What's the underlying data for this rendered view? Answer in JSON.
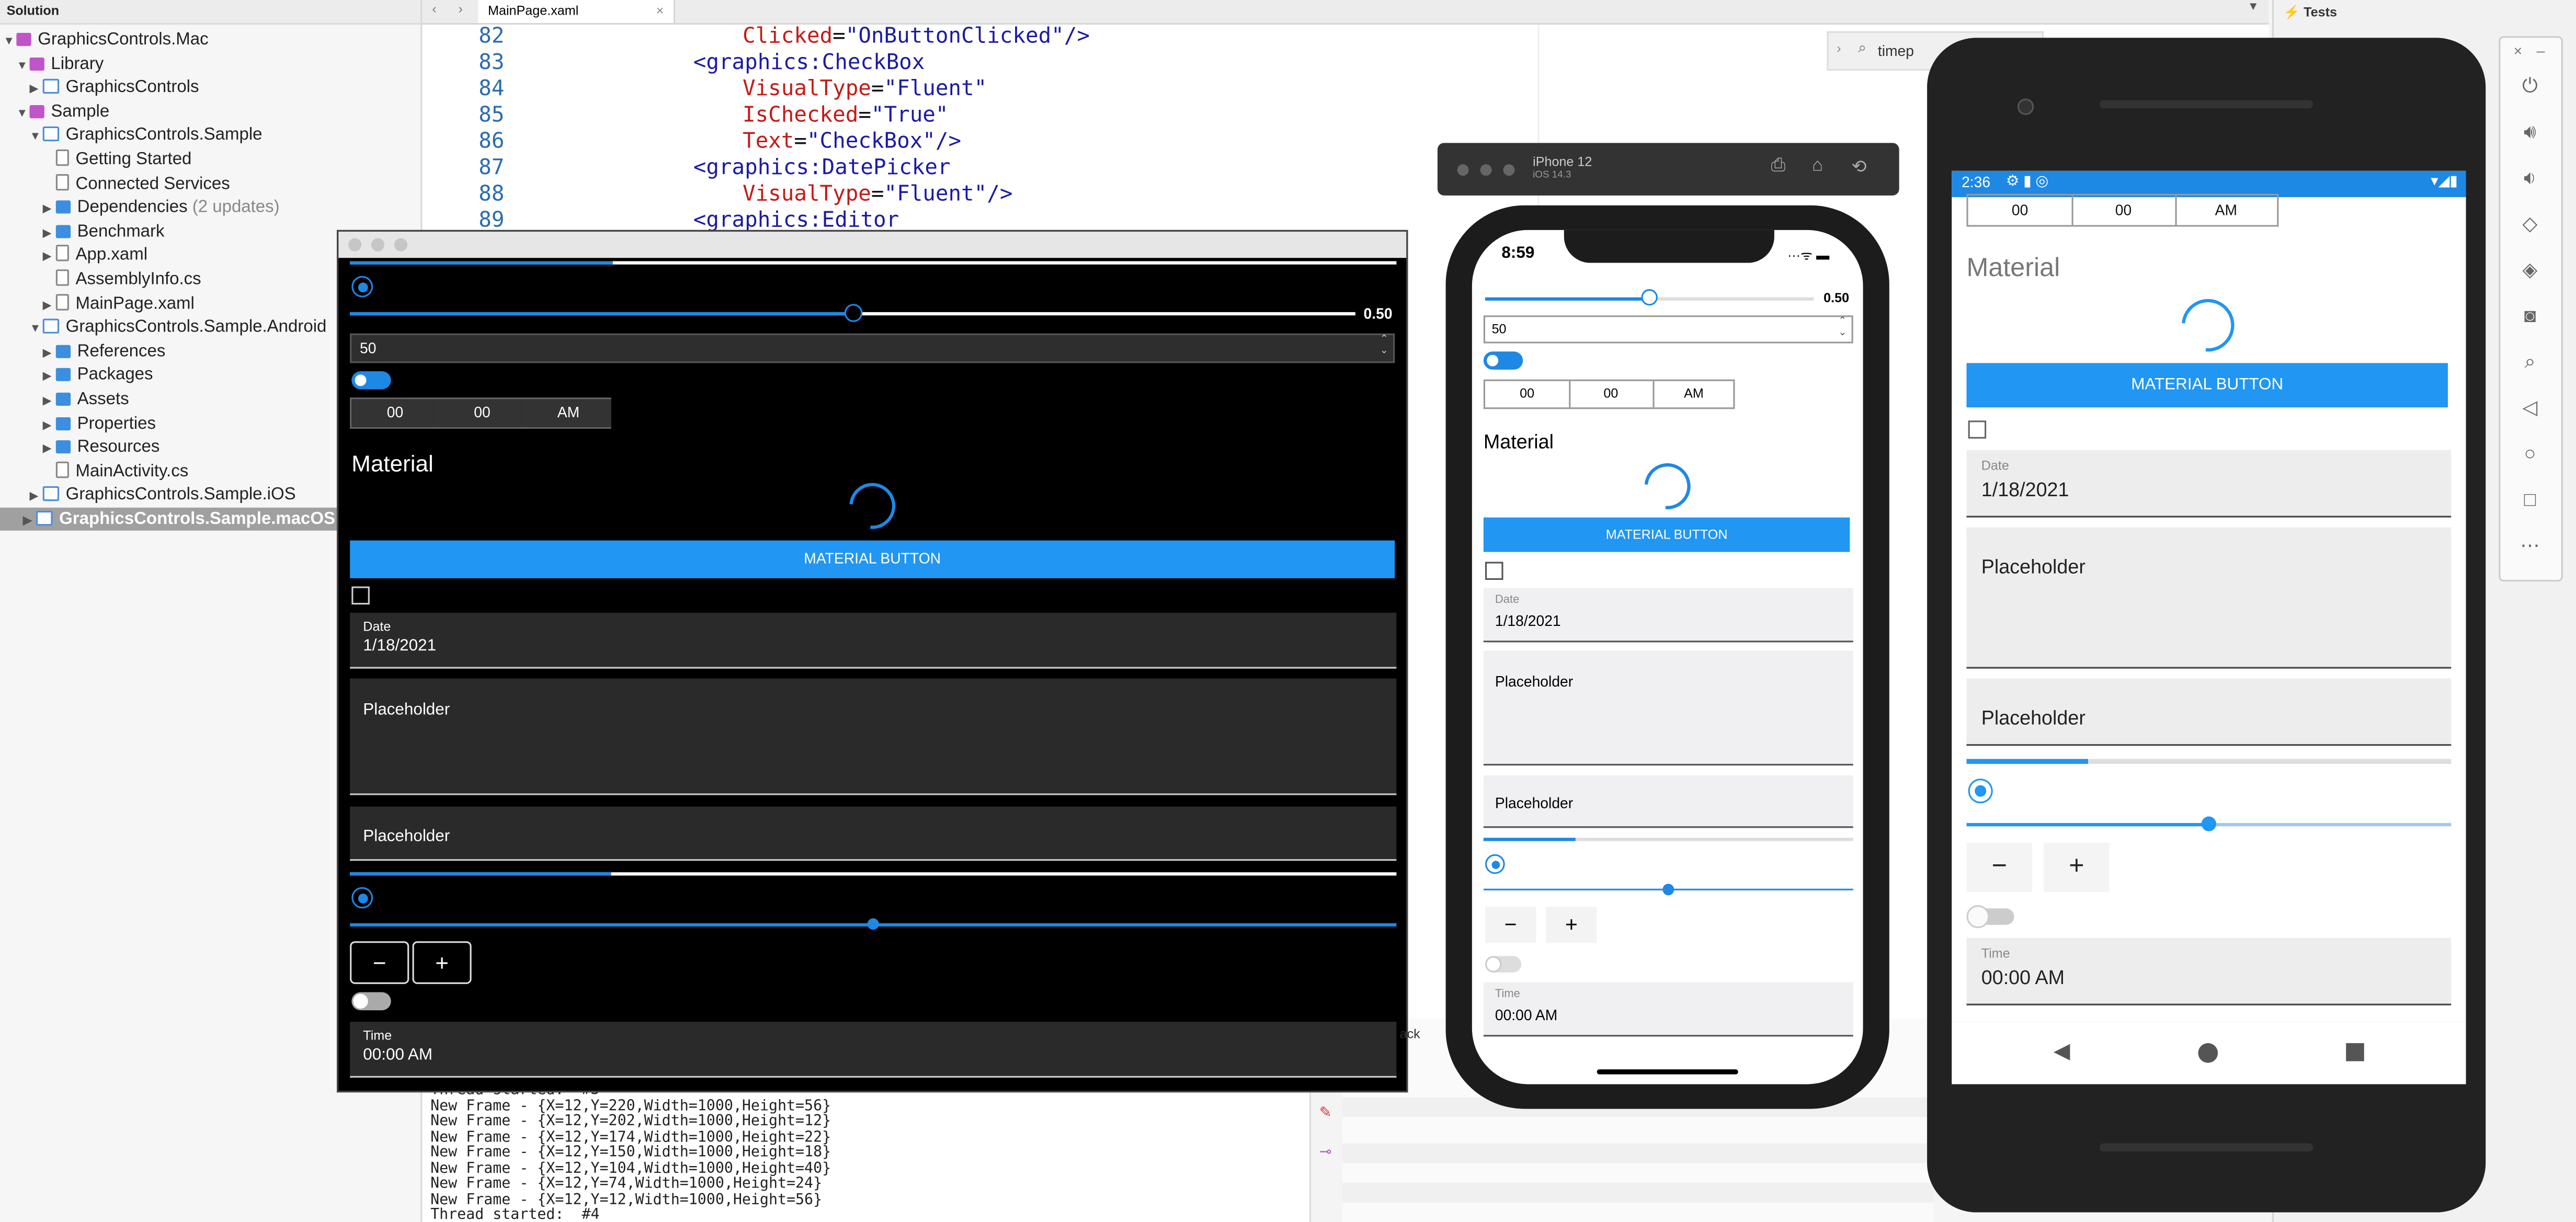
{
  "solution": {
    "header": "Solution",
    "items": [
      {
        "label": "GraphicsControls.Mac",
        "icon": "solution-icon",
        "level": 0,
        "expanded": true
      },
      {
        "label": "Library",
        "icon": "solution-folder-icon",
        "level": 1,
        "expanded": true
      },
      {
        "label": "GraphicsControls",
        "icon": "project-icon",
        "level": 2,
        "expanded": false
      },
      {
        "label": "Sample",
        "icon": "solution-folder-icon",
        "level": 1,
        "expanded": true
      },
      {
        "label": "GraphicsControls.Sample",
        "icon": "project-icon",
        "level": 2,
        "expanded": true
      },
      {
        "label": "Getting Started",
        "icon": "rocket-icon",
        "level": 3
      },
      {
        "label": "Connected Services",
        "icon": "connected-services-icon",
        "level": 3
      },
      {
        "label": "Dependencies",
        "suffix": "(2 updates)",
        "icon": "folder-icon",
        "level": 3,
        "expanded": false
      },
      {
        "label": "Benchmark",
        "icon": "folder-icon",
        "level": 3,
        "expanded": false
      },
      {
        "label": "App.xaml",
        "icon": "xaml-file-icon",
        "level": 3,
        "expanded": false
      },
      {
        "label": "AssemblyInfo.cs",
        "icon": "cs-file-icon",
        "level": 3
      },
      {
        "label": "MainPage.xaml",
        "icon": "xaml-file-icon",
        "level": 3,
        "expanded": false
      },
      {
        "label": "GraphicsControls.Sample.Android",
        "icon": "project-icon",
        "level": 2,
        "expanded": true
      },
      {
        "label": "References",
        "icon": "folder-icon",
        "level": 3,
        "expanded": false
      },
      {
        "label": "Packages",
        "icon": "folder-icon",
        "level": 3,
        "expanded": false
      },
      {
        "label": "Assets",
        "icon": "folder-icon",
        "level": 3,
        "expanded": false
      },
      {
        "label": "Properties",
        "icon": "folder-icon",
        "level": 3,
        "expanded": false
      },
      {
        "label": "Resources",
        "icon": "folder-icon",
        "level": 3,
        "expanded": false
      },
      {
        "label": "MainActivity.cs",
        "icon": "cs-file-icon",
        "level": 3
      },
      {
        "label": "GraphicsControls.Sample.iOS",
        "icon": "project-icon",
        "level": 2,
        "expanded": false
      },
      {
        "label": "GraphicsControls.Sample.macOS",
        "icon": "project-icon",
        "level": 2,
        "expanded": false,
        "selected": true
      }
    ]
  },
  "editor": {
    "tab": "MainPage.xaml",
    "search_value": "timep",
    "lines": [
      {
        "n": "82",
        "ind": 4,
        "parts": [
          [
            "attr",
            "Clicked"
          ],
          [
            "",
            "="
          ],
          [
            "str",
            "\"OnButtonClicked\""
          ],
          [
            "tag",
            "/>"
          ]
        ]
      },
      {
        "n": "83",
        "ind": 2,
        "parts": [
          [
            "tag",
            "<graphics:CheckBox"
          ]
        ]
      },
      {
        "n": "84",
        "ind": 4,
        "parts": [
          [
            "attr",
            "VisualType"
          ],
          [
            "",
            "="
          ],
          [
            "str",
            "\"Fluent\""
          ]
        ]
      },
      {
        "n": "85",
        "ind": 4,
        "parts": [
          [
            "attr",
            "IsChecked"
          ],
          [
            "",
            "="
          ],
          [
            "str",
            "\"True\""
          ]
        ]
      },
      {
        "n": "86",
        "ind": 4,
        "parts": [
          [
            "attr",
            "Text"
          ],
          [
            "",
            "="
          ],
          [
            "str",
            "\"CheckBox\""
          ],
          [
            "tag",
            "/>"
          ]
        ]
      },
      {
        "n": "87",
        "ind": 2,
        "parts": [
          [
            "tag",
            "<graphics:DatePicker"
          ]
        ]
      },
      {
        "n": "88",
        "ind": 4,
        "parts": [
          [
            "attr",
            "VisualType"
          ],
          [
            "",
            "="
          ],
          [
            "str",
            "\"Fluent\""
          ],
          [
            "tag",
            "/>"
          ]
        ]
      },
      {
        "n": "89",
        "ind": 2,
        "parts": [
          [
            "tag",
            "<graphics:Editor"
          ]
        ]
      }
    ]
  },
  "console": [
    "Thread started:  #3",
    "New Frame - {X=12,Y=220,Width=1000,Height=56}",
    "New Frame - {X=12,Y=202,Width=1000,Height=12}",
    "New Frame - {X=12,Y=174,Width=1000,Height=22}",
    "New Frame - {X=12,Y=150,Width=1000,Height=18}",
    "New Frame - {X=12,Y=104,Width=1000,Height=40}",
    "New Frame - {X=12,Y=74,Width=1000,Height=24}",
    "New Frame - {X=12,Y=12,Width=1000,Height=56}",
    "Thread started:  #4"
  ],
  "right_panel": {
    "title": "Tests"
  },
  "mac_app": {
    "slider_value_label": "0.50",
    "slider_value": 0.5,
    "stepper_value": "50",
    "time_hour": "00",
    "time_minute": "00",
    "time_ampm": "AM",
    "section_title": "Material",
    "button_label": "MATERIAL BUTTON",
    "date_label": "Date",
    "date_value": "1/18/2021",
    "editor_placeholder": "Placeholder",
    "entry_placeholder": "Placeholder",
    "progress": 0.25,
    "slider2_value": 0.5,
    "minus": "−",
    "plus": "+",
    "time_label": "Time",
    "time_value": "00:00 AM"
  },
  "iphone": {
    "device_name": "iPhone 12",
    "os": "iOS 14.3",
    "clock": "8:59",
    "slider_value_label": "0.50",
    "slider_value": 0.5,
    "stepper_value": "50",
    "time_hour": "00",
    "time_minute": "00",
    "time_ampm": "AM",
    "section_title": "Material",
    "button_label": "MATERIAL BUTTON",
    "date_label": "Date",
    "date_value": "1/18/2021",
    "editor_placeholder": "Placeholder",
    "entry_placeholder": "Placeholder",
    "progress": 0.25,
    "slider2_value": 0.5,
    "minus": "−",
    "plus": "+",
    "time_label": "Time",
    "time_value": "00:00 AM"
  },
  "android": {
    "clock": "2:36",
    "time_hour": "00",
    "time_minute": "00",
    "time_ampm": "AM",
    "section_title": "Material",
    "button_label": "MATERIAL BUTTON",
    "date_label": "Date",
    "date_value": "1/18/2021",
    "editor_placeholder": "Placeholder",
    "entry_placeholder": "Placeholder",
    "progress": 0.25,
    "slider_value": 0.5,
    "minus": "−",
    "plus": "+",
    "time_label": "Time",
    "time_value": "00:00 AM",
    "accent": "#2196f3"
  },
  "colors": {
    "accent": "#1e88e5",
    "material_blue": "#2196f3",
    "mac_bg": "#000000"
  }
}
